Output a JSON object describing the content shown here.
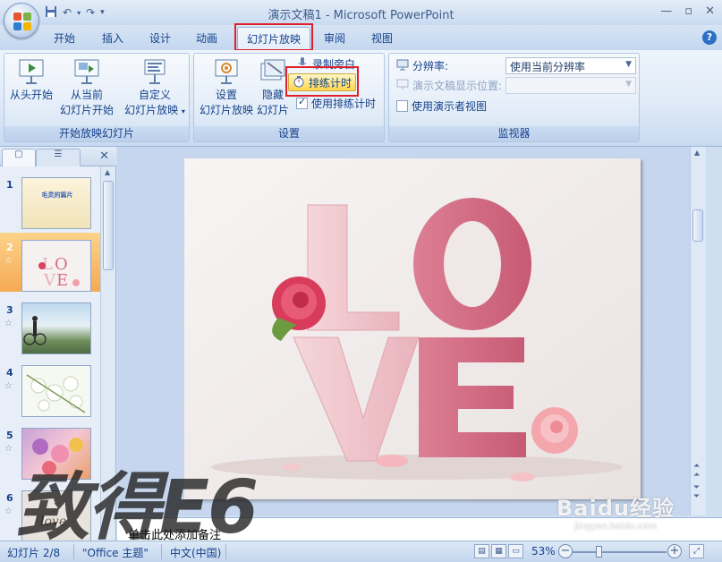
{
  "window": {
    "title": "演示文稿1 - Microsoft PowerPoint"
  },
  "tabs": [
    {
      "label": "开始"
    },
    {
      "label": "插入"
    },
    {
      "label": "设计"
    },
    {
      "label": "动画"
    },
    {
      "label": "幻灯片放映",
      "active": true
    },
    {
      "label": "审阅"
    },
    {
      "label": "视图"
    }
  ],
  "ribbon": {
    "group_start": {
      "label": "开始放映幻灯片",
      "from_beginning": "从头开始",
      "from_current_line1": "从当前",
      "from_current_line2": "幻灯片开始",
      "custom_line1": "自定义",
      "custom_line2": "幻灯片放映"
    },
    "group_setup": {
      "label": "设置",
      "setup_line1": "设置",
      "setup_line2": "幻灯片放映",
      "hide_line1": "隐藏",
      "hide_line2": "幻灯片",
      "record_narration": "录制旁白",
      "rehearse_timings": "排练计时",
      "use_rehearsed_timings": "使用排练计时",
      "use_rehearsed_checked": true
    },
    "group_monitors": {
      "label": "监视器",
      "resolution_label": "分辨率:",
      "resolution_value": "使用当前分辨率",
      "show_on_label": "演示文稿显示位置:",
      "show_on_value": "",
      "presenter_view": "使用演示者视图",
      "presenter_view_checked": false
    }
  },
  "slides": [
    {
      "num": "1",
      "title": "毛灵的篇片"
    },
    {
      "num": "2",
      "has_star": true,
      "selected": true
    },
    {
      "num": "3",
      "has_star": true
    },
    {
      "num": "4",
      "has_star": true
    },
    {
      "num": "5",
      "has_star": true
    },
    {
      "num": "6",
      "has_star": true
    }
  ],
  "current_slide": {
    "letters": "LOVE"
  },
  "notes": {
    "placeholder": "单击此处添加备注"
  },
  "status": {
    "slide_info": "幻灯片 2/8",
    "theme": "\"Office 主题\"",
    "language": "中文(中国)",
    "zoom": "53%"
  },
  "watermarks": {
    "left": "致得E6",
    "right_brand": "Baidu经验",
    "right_url": "jingyan.baidu.com"
  },
  "colors": {
    "accent_red": "#e0202a",
    "ribbon_text": "#15428b",
    "highlight": "#ffd64c"
  }
}
